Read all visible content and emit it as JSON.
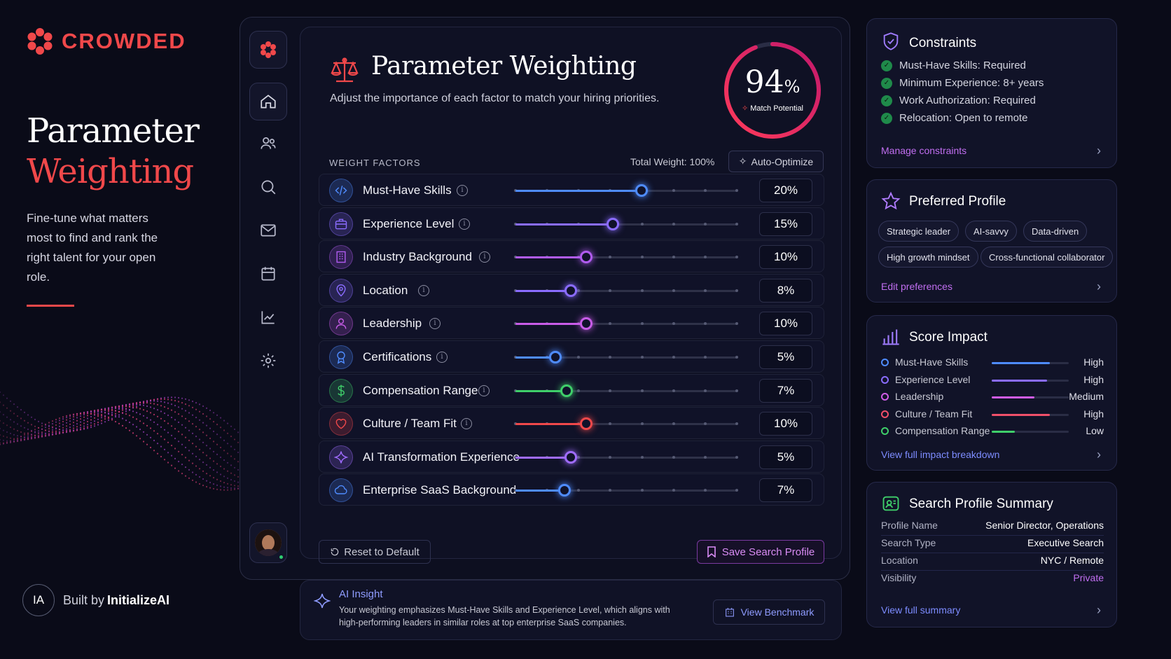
{
  "brand": {
    "name": "CROWDED",
    "accent_color": "#f0484a"
  },
  "hero": {
    "title_line1": "Parameter",
    "title_line2": "Weighting",
    "subtitle": "Fine-tune what matters most to find and rank the right talent for your open role."
  },
  "footer": {
    "badge": "IA",
    "built_prefix": "Built by",
    "built_name": "InitializeAI"
  },
  "nav_rail": {
    "items": [
      "logo-icon",
      "home-icon",
      "users-icon",
      "search-icon",
      "mail-icon",
      "calendar-icon",
      "analytics-icon",
      "settings-icon"
    ]
  },
  "panel": {
    "title": "Parameter Weighting",
    "subtitle": "Adjust the importance of each factor to match your hiring priorities.",
    "match": {
      "value": "94",
      "unit": "%",
      "label": "Match Potential",
      "fraction": 0.94
    },
    "section_label": "WEIGHT FACTORS",
    "total_weight": "Total Weight: 100%",
    "auto_optimize": "Auto-Optimize",
    "factors": [
      {
        "label": "Must-Have Skills",
        "value": "20%",
        "slider": 0.57,
        "color": "#4f8cff",
        "icon": "code-icon",
        "info": true
      },
      {
        "label": "Experience Level",
        "value": "15%",
        "slider": 0.44,
        "color": "#8a6cff",
        "icon": "briefcase-icon",
        "info": true
      },
      {
        "label": "Industry Background",
        "value": "10%",
        "slider": 0.32,
        "color": "#b05cf0",
        "icon": "building-icon",
        "info": true
      },
      {
        "label": "Location",
        "value": "8%",
        "slider": 0.25,
        "color": "#8a6cff",
        "icon": "location-pin-icon",
        "info": true
      },
      {
        "label": "Leadership",
        "value": "10%",
        "slider": 0.32,
        "color": "#c85ce8",
        "icon": "person-icon",
        "info": true
      },
      {
        "label": "Certifications",
        "value": "5%",
        "slider": 0.18,
        "color": "#4f8cff",
        "icon": "badge-icon",
        "info": true
      },
      {
        "label": "Compensation Range",
        "value": "7%",
        "slider": 0.23,
        "color": "#3fcf6a",
        "icon": "dollar-icon",
        "info": true
      },
      {
        "label": "Culture / Team Fit",
        "value": "10%",
        "slider": 0.32,
        "color": "#f0484a",
        "icon": "heart-icon",
        "info": true
      },
      {
        "label": "AI Transformation Experience",
        "value": "5%",
        "slider": 0.25,
        "color": "#a06cff",
        "icon": "sparkle-icon",
        "info": false
      },
      {
        "label": "Enterprise SaaS Background",
        "value": "7%",
        "slider": 0.22,
        "color": "#4f8cff",
        "icon": "cloud-icon",
        "info": false
      }
    ],
    "reset_label": "Reset to Default",
    "save_label": "Save Search Profile"
  },
  "insight": {
    "title": "AI Insight",
    "text": "Your weighting emphasizes Must-Have Skills and Experience Level, which aligns with high-performing leaders in similar roles at top enterprise SaaS companies.",
    "button": "View Benchmark"
  },
  "constraints": {
    "title": "Constraints",
    "items": [
      "Must-Have Skills: Required",
      "Minimum Experience: 8+ years",
      "Work Authorization: Required",
      "Relocation: Open to remote"
    ],
    "link": "Manage constraints"
  },
  "preferred": {
    "title": "Preferred Profile",
    "chips": [
      "Strategic leader",
      "AI-savvy",
      "Data-driven",
      "High growth mindset",
      "Cross-functional collaborator"
    ],
    "link": "Edit preferences"
  },
  "score_impact": {
    "title": "Score Impact",
    "rows": [
      {
        "name": "Must-Have Skills",
        "level": "High",
        "fraction": 0.75,
        "color": "#4f8cff"
      },
      {
        "name": "Experience Level",
        "level": "High",
        "fraction": 0.72,
        "color": "#8a6cff"
      },
      {
        "name": "Leadership",
        "level": "Medium",
        "fraction": 0.55,
        "color": "#d05ce8"
      },
      {
        "name": "Culture / Team Fit",
        "level": "High",
        "fraction": 0.75,
        "color": "#f0506a"
      },
      {
        "name": "Compensation Range",
        "level": "Low",
        "fraction": 0.3,
        "color": "#3fcf6a"
      }
    ],
    "link": "View full impact breakdown"
  },
  "summary": {
    "title": "Search Profile Summary",
    "rows": [
      {
        "key": "Profile Name",
        "value": "Senior Director, Operations"
      },
      {
        "key": "Search Type",
        "value": "Executive Search"
      },
      {
        "key": "Location",
        "value": "NYC / Remote"
      },
      {
        "key": "Visibility",
        "value": "Private"
      }
    ],
    "link": "View full summary"
  }
}
